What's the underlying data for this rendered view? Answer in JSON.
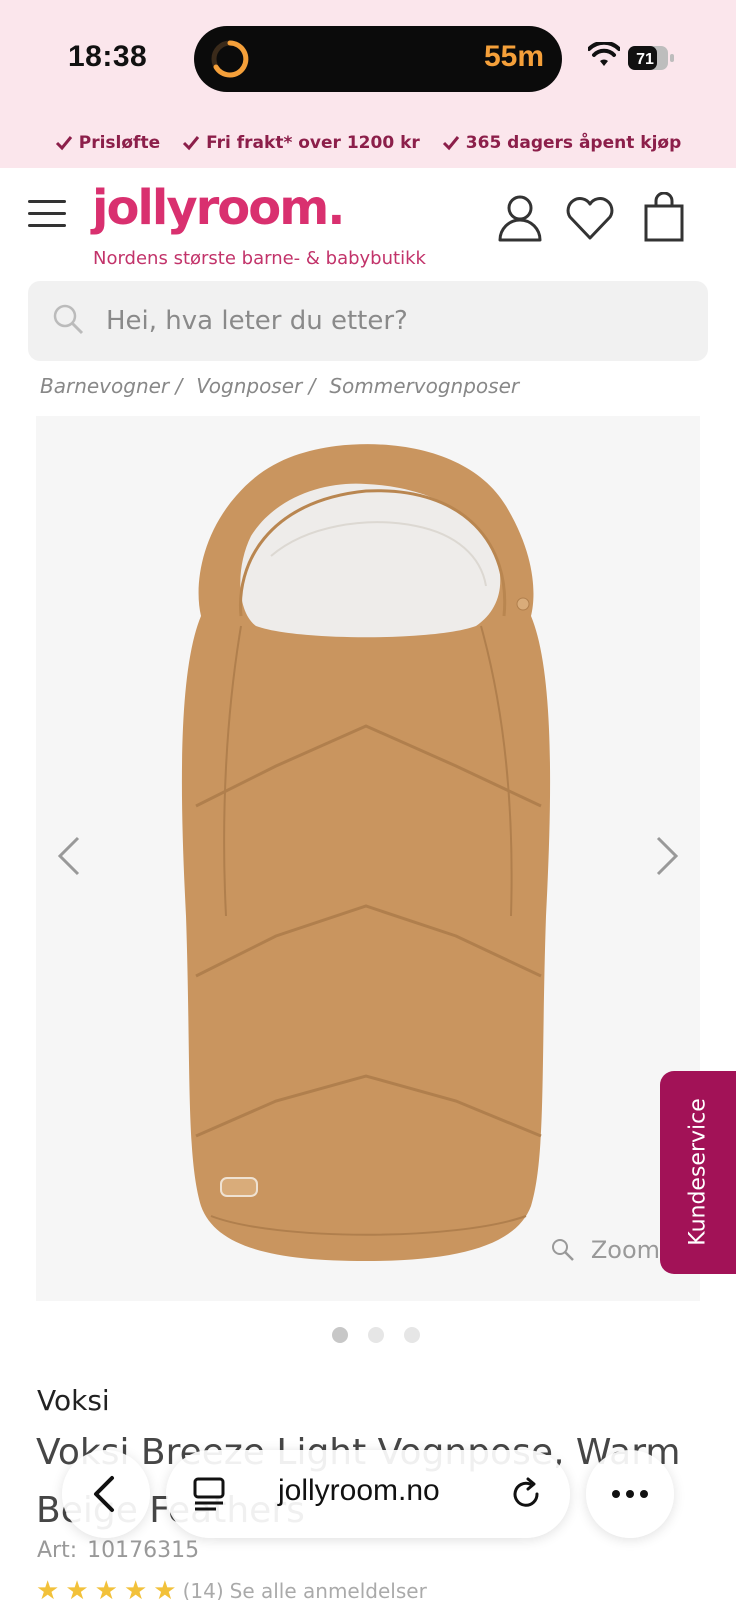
{
  "status_bar": {
    "time": "18:38",
    "activity_label": "55m",
    "battery": "71"
  },
  "promo": {
    "items": [
      "Prisløfte",
      "Fri frakt* over 1200 kr",
      "365 dagers åpent kjøp"
    ]
  },
  "header": {
    "logo": "jollyroom.",
    "tagline": "Nordens største barne- & babybutikk"
  },
  "search": {
    "placeholder": "Hei, hva leter du etter?"
  },
  "breadcrumb": [
    "Barnevogner /",
    "Vognposer /",
    "Sommervognposer"
  ],
  "gallery": {
    "zoom_label": "Zoom",
    "slide_count": 3,
    "active_slide": 1,
    "product_color": "#c9955f"
  },
  "support": {
    "label": "Kundeservice"
  },
  "product": {
    "brand": "Voksi",
    "title": "Voksi Breeze Light Vognpose, Warm Beige Feathers",
    "art_label": "Art:",
    "art_number": "10176315",
    "rating_count": "(14)",
    "reviews_link": "Se alle anmeldelser"
  },
  "browser": {
    "url": "jollyroom.no"
  },
  "colors": {
    "promo_bg": "#fbe6ec",
    "brand_pink": "#d9306f",
    "support_bg": "#a21257"
  }
}
